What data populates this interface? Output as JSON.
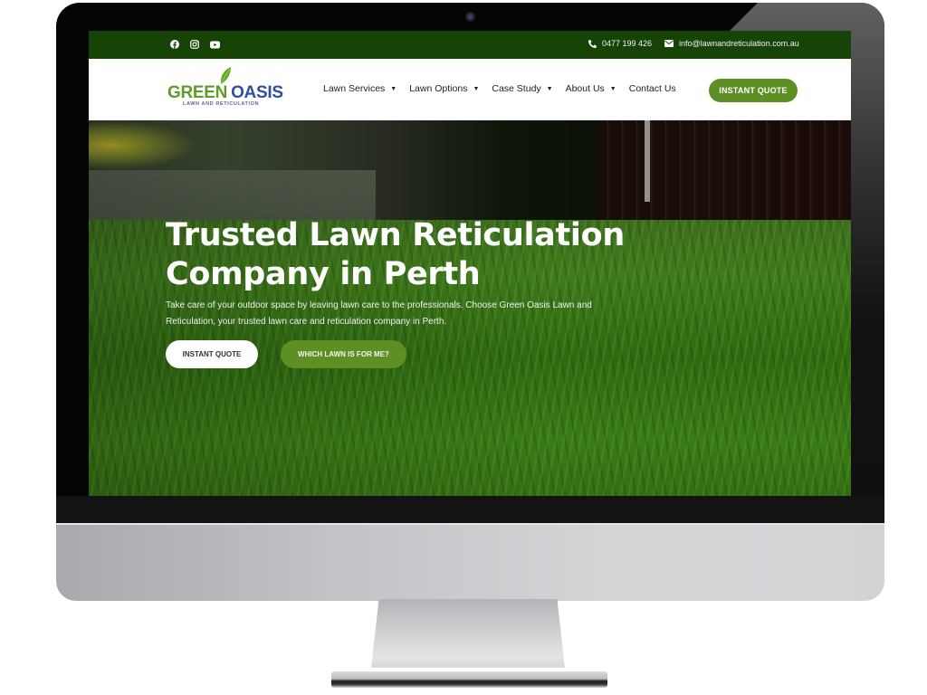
{
  "topbar": {
    "social": [
      {
        "icon": "facebook-icon",
        "label": "Facebook"
      },
      {
        "icon": "instagram-icon",
        "label": "Instagram"
      },
      {
        "icon": "youtube-icon",
        "label": "YouTube"
      }
    ],
    "phone": "0477 199 426",
    "email": "info@lawnandreticulation.com.au"
  },
  "logo": {
    "word1": "GREEN",
    "word2": "OASIS",
    "tagline": "LAWN AND RETICULATION"
  },
  "nav": {
    "items": [
      {
        "label": "Lawn Services",
        "has_dropdown": "▼"
      },
      {
        "label": "Lawn Options",
        "has_dropdown": "▼"
      },
      {
        "label": "Case Study",
        "has_dropdown": "▼"
      },
      {
        "label": "About Us",
        "has_dropdown": "▼"
      },
      {
        "label": "Contact Us"
      }
    ],
    "cta": "INSTANT QUOTE"
  },
  "hero": {
    "title": "Trusted Lawn Reticulation Company in Perth",
    "text": "Take care of your outdoor space by leaving lawn care to the professionals. Choose Green Oasis Lawn and Reticulation, your trusted lawn care and reticulation company in Perth.",
    "primary_button": "INSTANT QUOTE",
    "secondary_button": "WHICH LAWN IS FOR ME?"
  },
  "colors": {
    "topbar": "#164306",
    "accent": "#5e8f24",
    "logo_green": "#5f9b2a",
    "logo_blue": "#2d4f9e"
  }
}
